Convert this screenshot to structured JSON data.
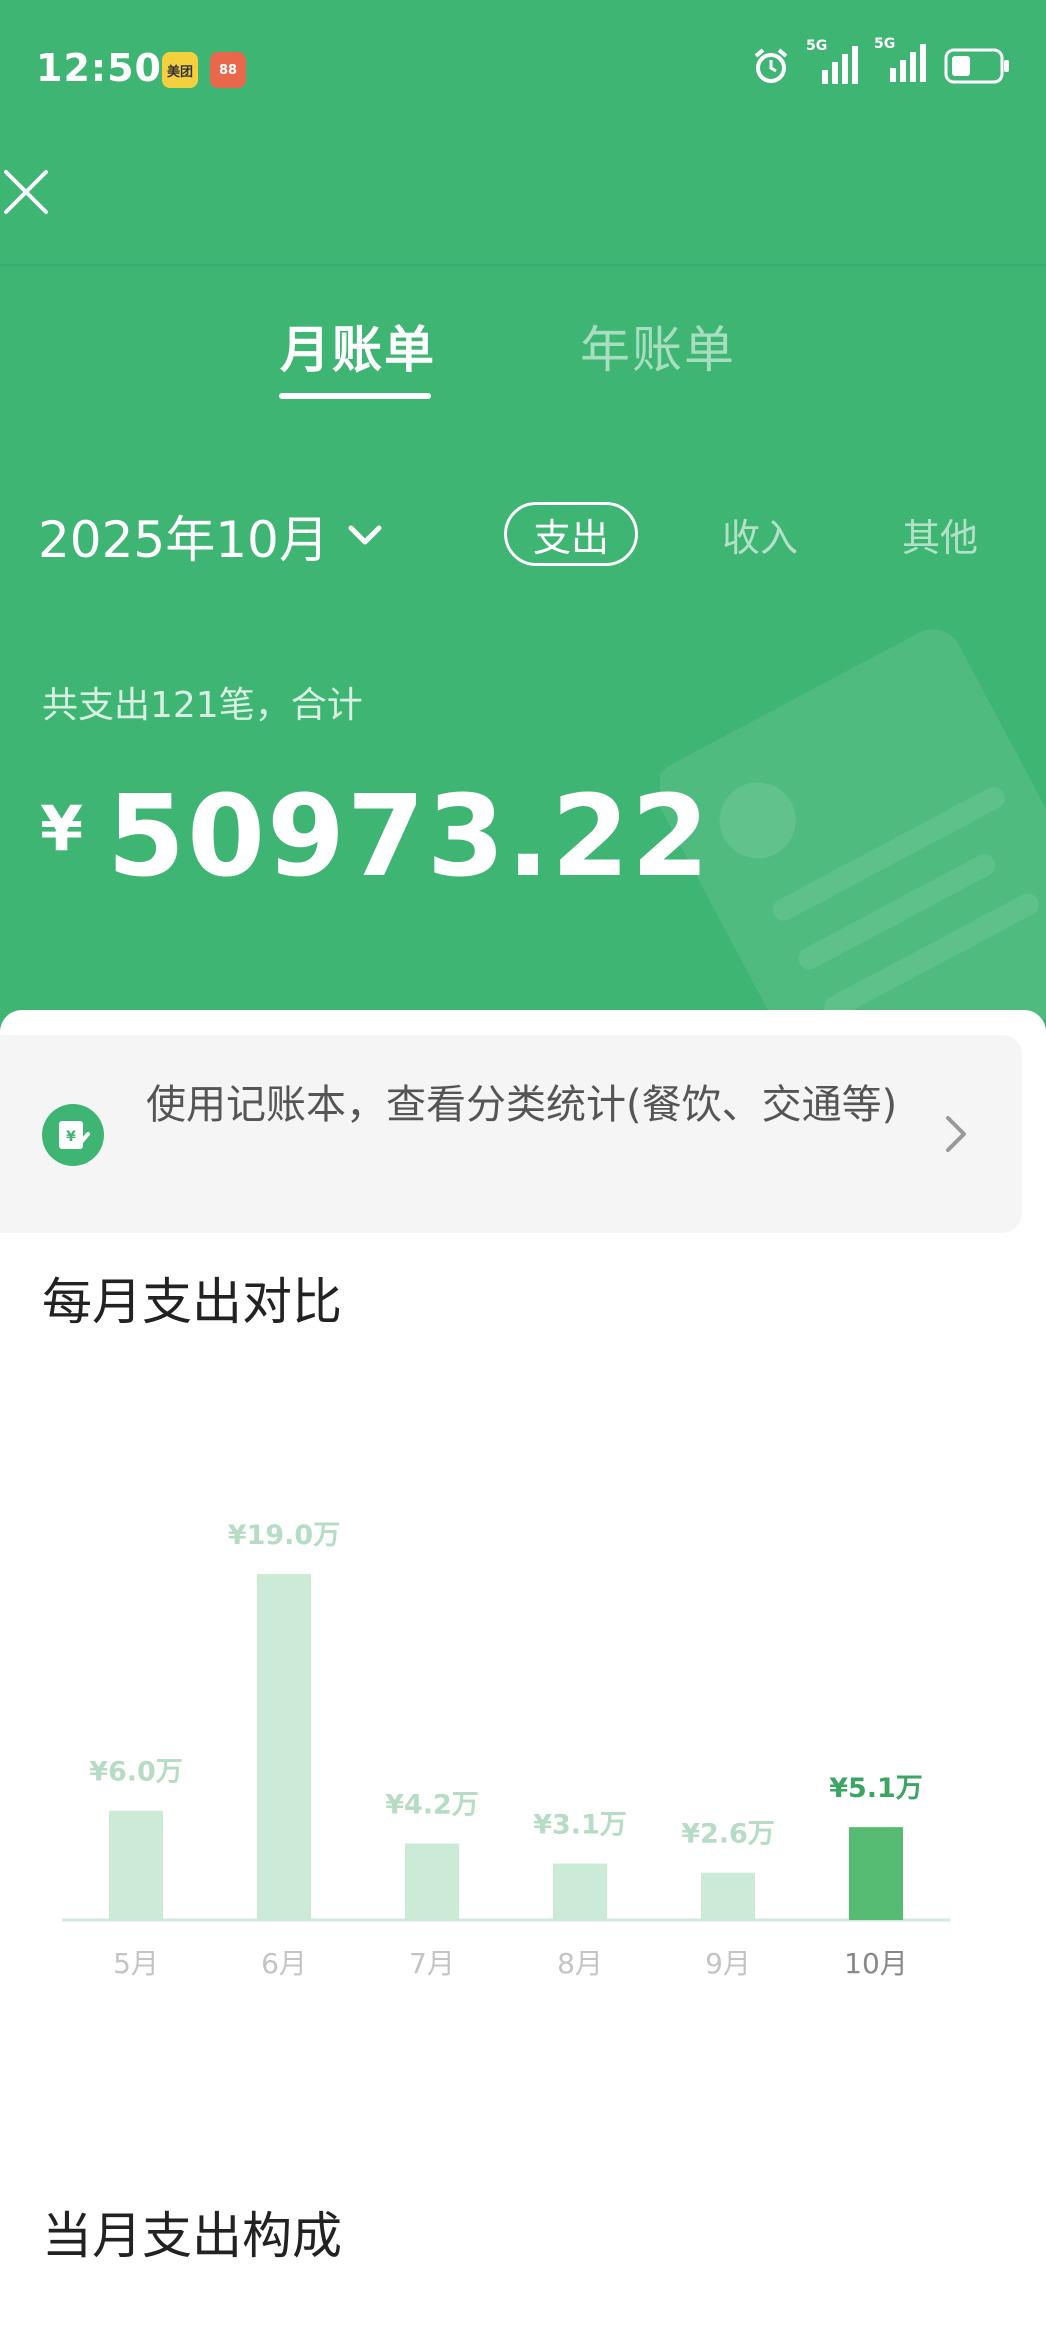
{
  "status_bar": {
    "time": "12:50",
    "app_badges": [
      "美团",
      "88"
    ],
    "signal_1": "5G",
    "signal_2": "5G"
  },
  "tabs": {
    "month": "月账单",
    "year": "年账单"
  },
  "date": "2025年10月",
  "types": {
    "expense": "支出",
    "income": "收入",
    "other": "其他"
  },
  "summary": {
    "text": "共支出121笔，合计",
    "currency": "¥",
    "amount": "50973.22"
  },
  "banner": {
    "text": "使用记账本，查看分类统计(餐饮、交通等)"
  },
  "sections": {
    "monthly_compare": "每月支出对比",
    "month_composition": "当月支出构成"
  },
  "colors": {
    "brand": "#3FB573",
    "bar_light": "#CBEBD7",
    "bar_active": "#56BC73"
  },
  "chart_data": {
    "type": "bar",
    "categories": [
      "5月",
      "6月",
      "7月",
      "8月",
      "9月",
      "10月"
    ],
    "values": [
      6.0,
      19.0,
      4.2,
      3.1,
      2.6,
      5.1
    ],
    "data_labels": [
      "¥6.0万",
      "¥19.0万",
      "¥4.2万",
      "¥3.1万",
      "¥2.6万",
      "¥5.1万"
    ],
    "highlight_index": 5,
    "title": "每月支出对比",
    "unit": "万"
  }
}
